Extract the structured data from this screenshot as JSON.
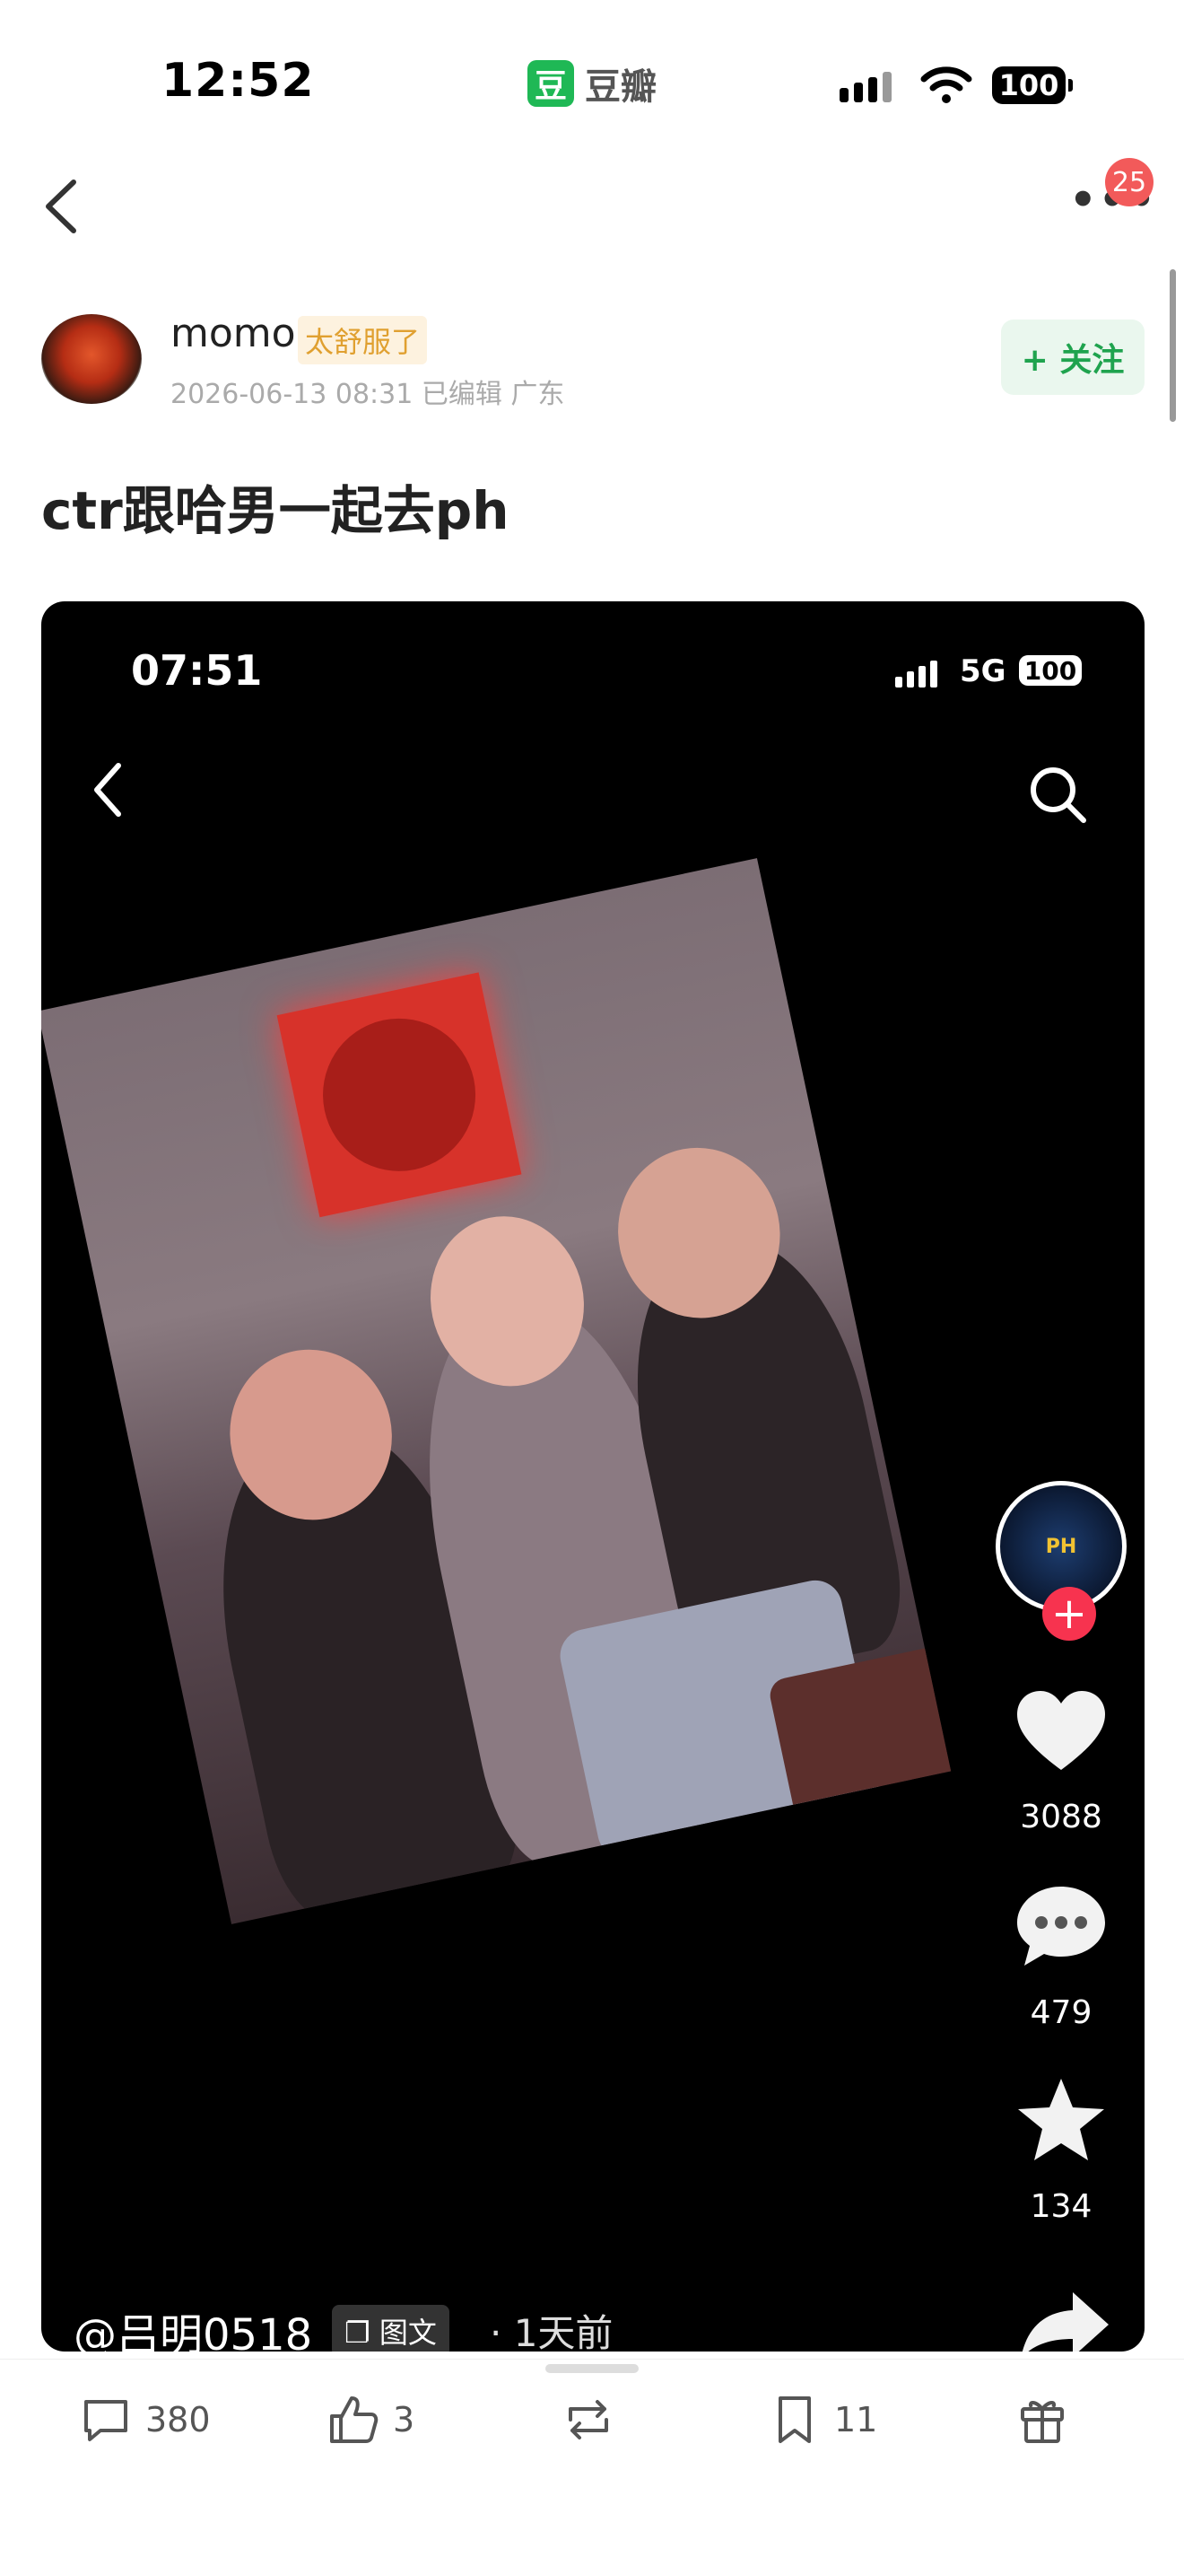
{
  "status_bar": {
    "time": "12:52",
    "app_logo": "豆",
    "app_name": "豆瓣",
    "battery": "100"
  },
  "nav": {
    "badge": "25"
  },
  "author": {
    "name": "momo",
    "tag": "太舒服了",
    "meta": "2026-06-13 08:31  已编辑  广东",
    "follow_label": "+ 关注"
  },
  "post": {
    "title": "ctr跟哈男一起去ph"
  },
  "embedded": {
    "time": "07:51",
    "network": "5G",
    "battery": "100",
    "avatar_text": "PH",
    "likes": "3088",
    "comments": "479",
    "favorites": "134",
    "username": "@吕明0518",
    "post_type": "图文",
    "posted": "· 1天前"
  },
  "bottom_bar": {
    "comments": "380",
    "likes": "3",
    "shares": "",
    "bookmarks": "11"
  },
  "colors": {
    "brand_green": "#1fb855",
    "badge_red": "#f25a5a",
    "follow_green": "#1fa34e"
  }
}
